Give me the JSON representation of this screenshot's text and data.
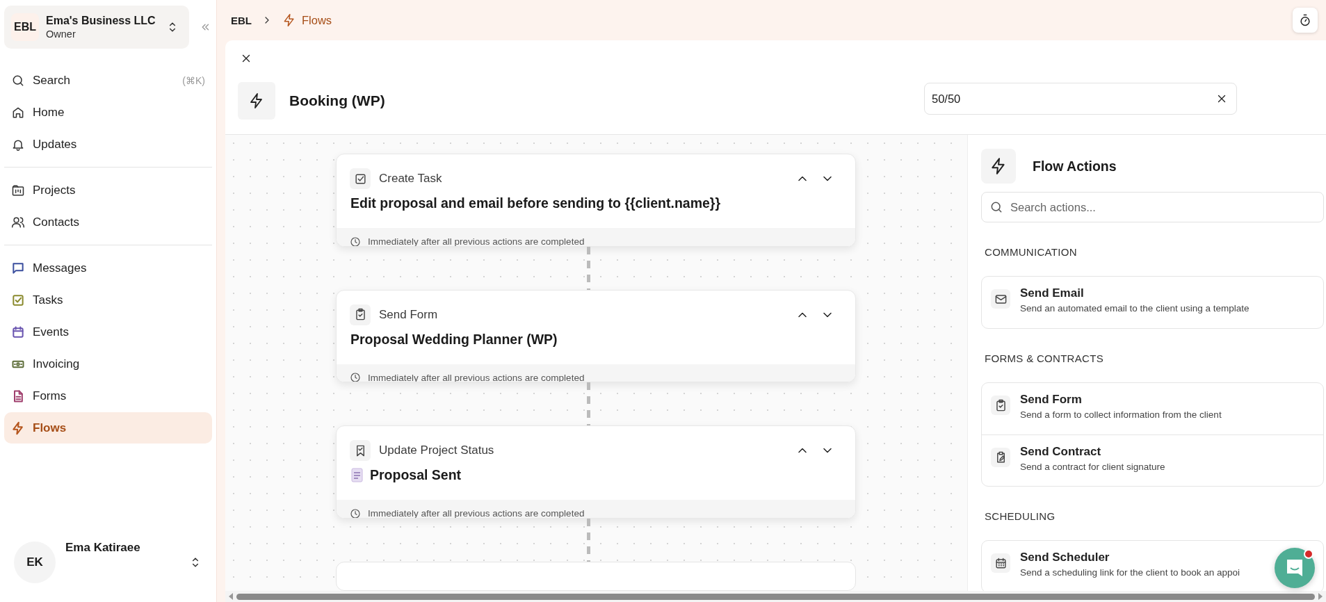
{
  "workspace": {
    "initials": "EBL",
    "name": "Ema's Business LLC",
    "role": "Owner"
  },
  "sidebar": {
    "sections": [
      {
        "items": [
          {
            "label": "Search",
            "shortcut": "(⌘K)",
            "selected": false
          },
          {
            "label": "Home",
            "selected": false
          },
          {
            "label": "Updates",
            "selected": false
          }
        ]
      },
      {
        "items": [
          {
            "label": "Projects",
            "selected": false
          },
          {
            "label": "Contacts",
            "selected": false
          }
        ]
      },
      {
        "items": [
          {
            "label": "Messages",
            "selected": false,
            "color": "#3b4f9e"
          },
          {
            "label": "Tasks",
            "selected": false,
            "color": "#8a8a2e"
          },
          {
            "label": "Events",
            "selected": false,
            "color": "#6a55b0"
          },
          {
            "label": "Invoicing",
            "selected": false,
            "color": "#5e6e3a"
          },
          {
            "label": "Forms",
            "selected": false,
            "color": "#a0406e"
          },
          {
            "label": "Flows",
            "selected": true,
            "color": "#b5561e"
          }
        ]
      }
    ]
  },
  "user": {
    "initials": "EK",
    "name": "Ema Katiraee"
  },
  "breadcrumb": [
    {
      "label": "EBL"
    },
    {
      "label": "Flows"
    }
  ],
  "flow": {
    "title": "Booking (WP)",
    "field_value": "50/50"
  },
  "steps": [
    {
      "kind": "task",
      "type": "Create Task",
      "title": "Edit proposal and email before sending to {{client.name}}",
      "timing": "Immediately after all previous actions are completed"
    },
    {
      "kind": "form",
      "type": "Send Form",
      "title": "Proposal Wedding Planner (WP)",
      "timing": "Immediately after all previous actions are completed"
    },
    {
      "kind": "status",
      "type": "Update Project Status",
      "title": "Proposal Sent",
      "timing": "Immediately after all previous actions are completed"
    }
  ],
  "panel": {
    "title": "Flow Actions",
    "search_placeholder": "Search actions...",
    "sections": [
      {
        "heading": "COMMUNICATION",
        "actions": [
          {
            "kind": "email",
            "title": "Send Email",
            "description": "Send an automated email to the client using a template"
          }
        ]
      },
      {
        "heading": "FORMS & CONTRACTS",
        "actions": [
          {
            "kind": "form",
            "title": "Send Form",
            "description": "Send a form to collect information from the client"
          },
          {
            "kind": "contract",
            "title": "Send Contract",
            "description": "Send a contract for client signature"
          }
        ]
      },
      {
        "heading": "SCHEDULING",
        "actions": [
          {
            "kind": "scheduler",
            "title": "Send Scheduler",
            "description": "Send a scheduling link for the client to book an appoi"
          }
        ]
      }
    ]
  }
}
